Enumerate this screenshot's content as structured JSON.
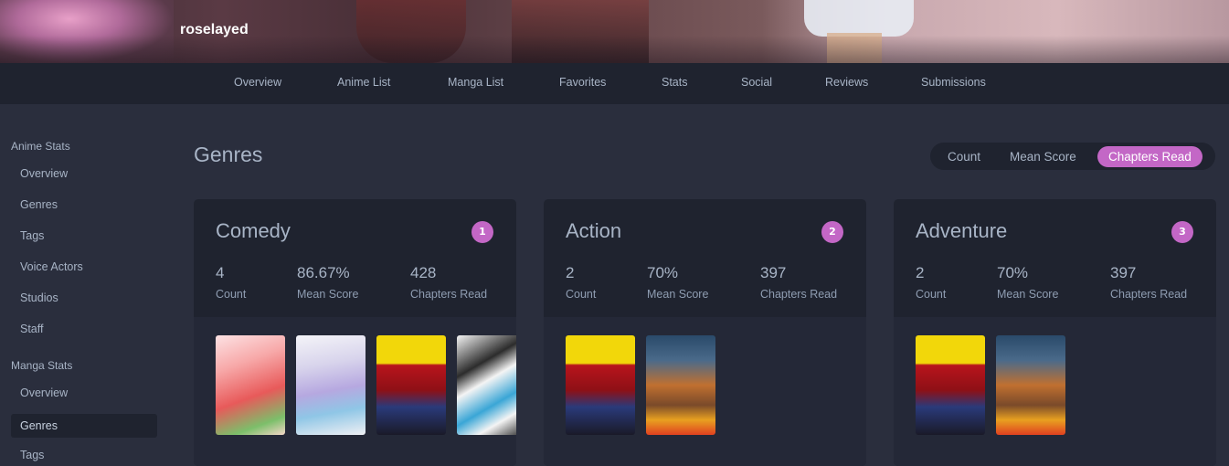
{
  "profile": {
    "username": "roselayed"
  },
  "nav": [
    "Overview",
    "Anime List",
    "Manga List",
    "Favorites",
    "Stats",
    "Social",
    "Reviews",
    "Submissions"
  ],
  "sidebar": {
    "anime_heading": "Anime Stats",
    "anime_items": [
      "Overview",
      "Genres",
      "Tags",
      "Voice Actors",
      "Studios",
      "Staff"
    ],
    "manga_heading": "Manga Stats",
    "manga_items": [
      "Overview",
      "Genres",
      "Tags"
    ]
  },
  "page": {
    "title": "Genres",
    "toggle": {
      "count": "Count",
      "mean_score": "Mean Score",
      "chapters_read": "Chapters Read"
    }
  },
  "labels": {
    "count": "Count",
    "mean_score": "Mean Score",
    "chapters_read": "Chapters Read"
  },
  "cards": [
    {
      "name": "Comedy",
      "rank": "1",
      "count": "4",
      "mean_score": "86.67%",
      "chapters_read": "428"
    },
    {
      "name": "Action",
      "rank": "2",
      "count": "2",
      "mean_score": "70%",
      "chapters_read": "397"
    },
    {
      "name": "Adventure",
      "rank": "3",
      "count": "2",
      "mean_score": "70%",
      "chapters_read": "397"
    }
  ],
  "colors": {
    "accent": "#c367c6",
    "background": "#2a2e3d",
    "panel": "#1f232f",
    "text": "#a8b4c6"
  }
}
